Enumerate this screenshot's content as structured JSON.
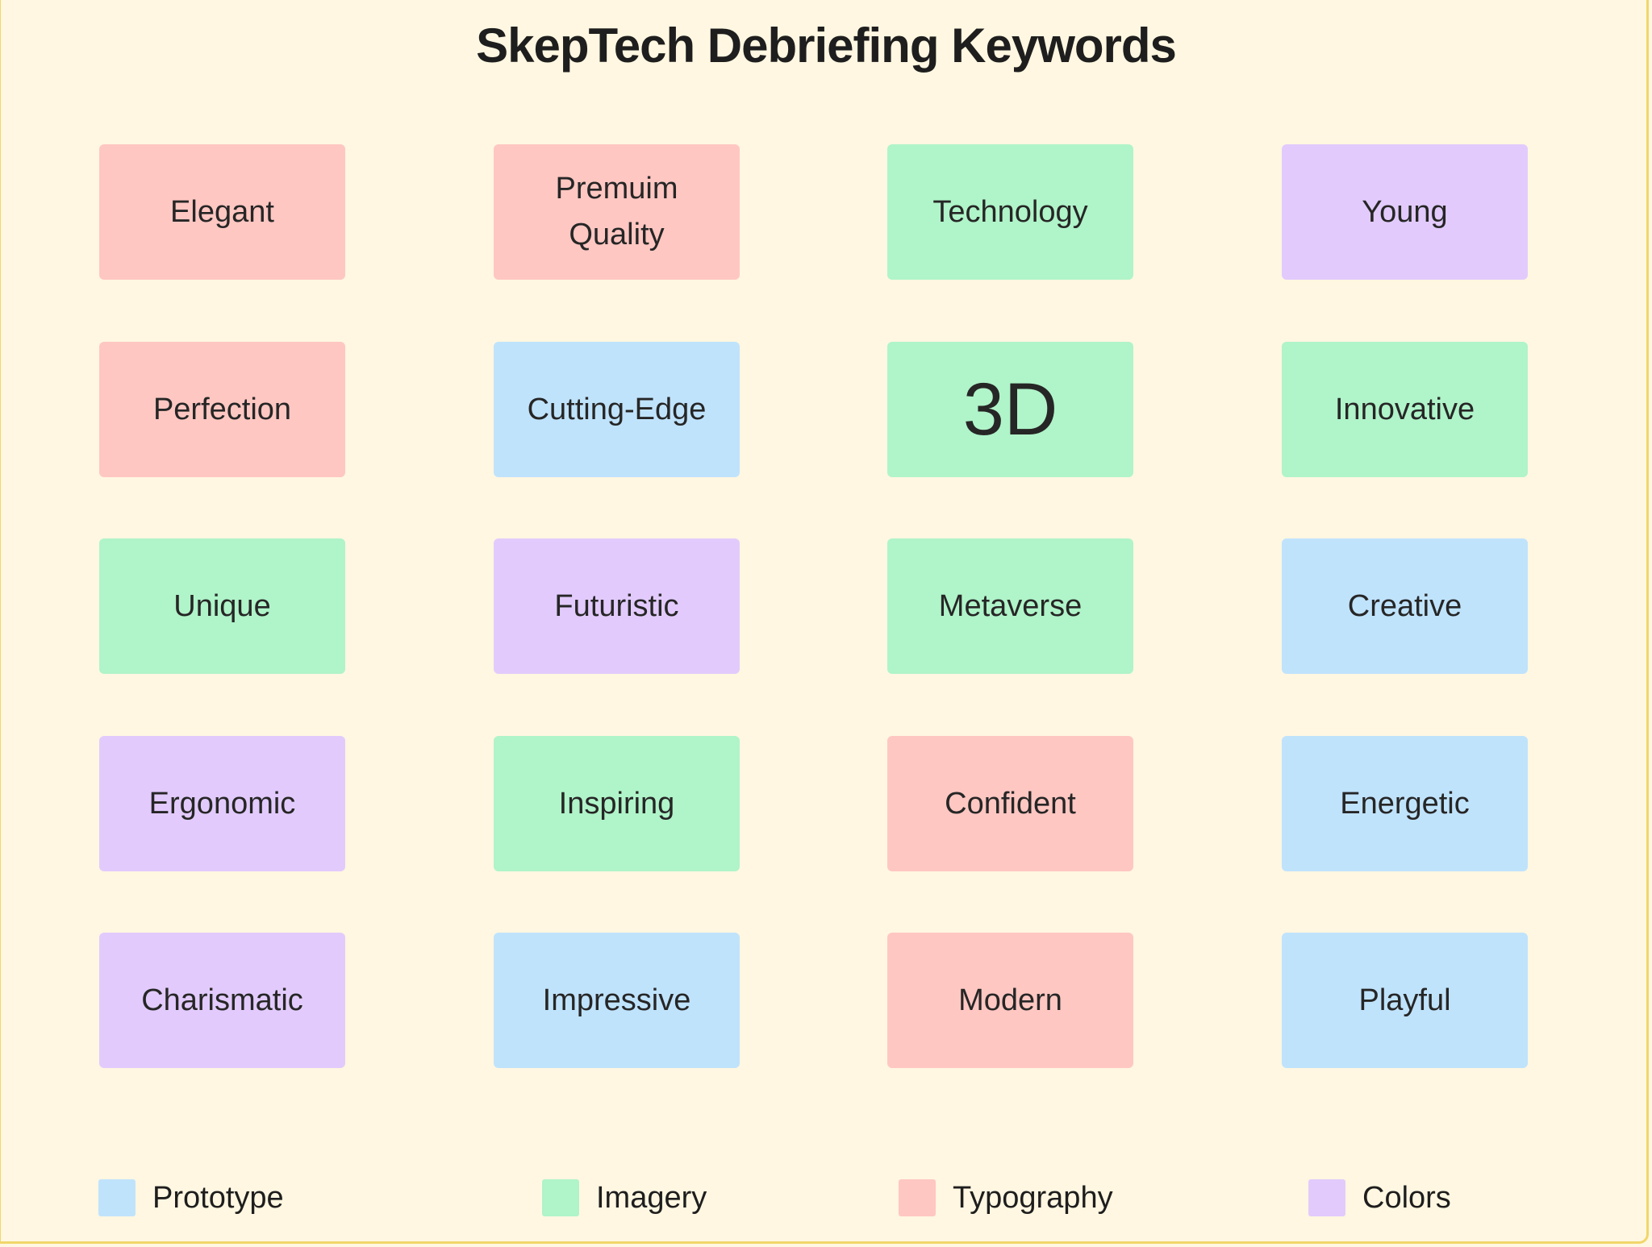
{
  "title": "SkepTech Debriefing Keywords",
  "categories": {
    "prototype": {
      "label": "Prototype",
      "color": "#c0e3fc"
    },
    "imagery": {
      "label": "Imagery",
      "color": "#b0f4c9"
    },
    "typography": {
      "label": "Typography",
      "color": "#ffc7c2"
    },
    "colors": {
      "label": "Colors",
      "color": "#e2cbfc"
    }
  },
  "legend": [
    {
      "label": "Prototype",
      "category": "prototype"
    },
    {
      "label": "Imagery",
      "category": "imagery"
    },
    {
      "label": "Typography",
      "category": "typography"
    },
    {
      "label": "Colors",
      "category": "colors"
    }
  ],
  "cards": [
    {
      "label": "Elegant",
      "category": "typography"
    },
    {
      "label": "Premuim Quality",
      "category": "typography"
    },
    {
      "label": "Technology",
      "category": "imagery"
    },
    {
      "label": "Young",
      "category": "colors"
    },
    {
      "label": "Perfection",
      "category": "typography"
    },
    {
      "label": "Cutting-Edge",
      "category": "prototype"
    },
    {
      "label": "3D",
      "category": "imagery",
      "emphasis": true
    },
    {
      "label": "Innovative",
      "category": "imagery"
    },
    {
      "label": "Unique",
      "category": "imagery"
    },
    {
      "label": "Futuristic",
      "category": "colors"
    },
    {
      "label": "Metaverse",
      "category": "imagery"
    },
    {
      "label": "Creative",
      "category": "prototype"
    },
    {
      "label": "Ergonomic",
      "category": "colors"
    },
    {
      "label": "Inspiring",
      "category": "imagery"
    },
    {
      "label": "Confident",
      "category": "typography"
    },
    {
      "label": "Energetic",
      "category": "prototype"
    },
    {
      "label": "Charismatic",
      "category": "colors"
    },
    {
      "label": "Impressive",
      "category": "prototype"
    },
    {
      "label": "Modern",
      "category": "typography"
    },
    {
      "label": "Playful",
      "category": "prototype"
    }
  ]
}
